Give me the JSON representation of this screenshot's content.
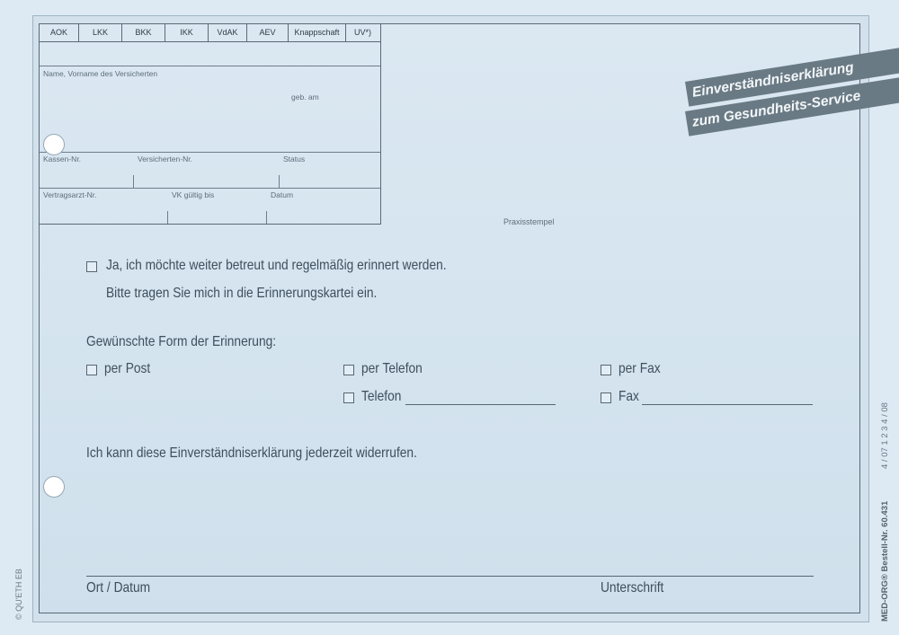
{
  "header": {
    "kassen": [
      "AOK",
      "LKK",
      "BKK",
      "IKK",
      "VdAK",
      "AEV",
      "Knappschaft",
      "UV*)"
    ],
    "name_label": "Name, Vorname des Versicherten",
    "geb_label": "geb. am",
    "kassen_nr_label": "Kassen-Nr.",
    "versicherten_nr_label": "Versicherten-Nr.",
    "status_label": "Status",
    "vertragsarzt_label": "Vertragsarzt-Nr.",
    "vk_label": "VK gültig bis",
    "datum_label": "Datum"
  },
  "stamp_label": "Praxisstempel",
  "banner": {
    "line1": "Einverständniserklärung",
    "line2": "zum Gesundheits-Service"
  },
  "consent": {
    "line1": "Ja, ich möchte weiter betreut und regelmäßig erinnert werden.",
    "line2": "Bitte tragen Sie mich in die Erinnerungskartei ein."
  },
  "reminder": {
    "heading": "Gewünschte Form der Erinnerung:",
    "post": "per Post",
    "telefon": "per Telefon",
    "fax": "per Fax",
    "telefon_field": "Telefon",
    "fax_field": "Fax"
  },
  "revoke_text": "Ich kann diese Einverständniserklärung jederzeit widerrufen.",
  "signature": {
    "place_date": "Ort / Datum",
    "signature": "Unterschrift"
  },
  "side": {
    "left": "© QU'ETH EB",
    "right_code": "MED-ORG® Bestell-Nr. 60.431",
    "right_dates": "4 / 07     1  2  3  4 / 08"
  }
}
